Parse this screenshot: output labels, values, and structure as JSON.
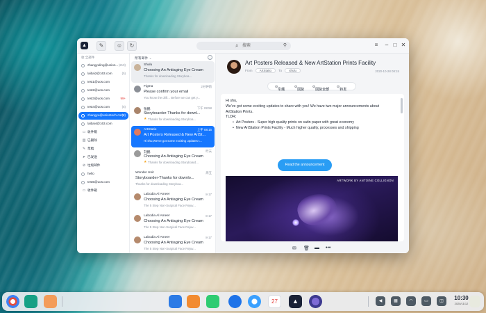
{
  "window": {
    "search_placeholder": "搜索"
  },
  "sidebar": {
    "header": "收 全部件",
    "accounts": [
      {
        "name": "zhangyuling@union...",
        "count": "(210)"
      },
      {
        "name": "laibai2@163.com",
        "count": "(5)"
      },
      {
        "name": "test1@uos.com",
        "count": ""
      },
      {
        "name": "test2@uos.com",
        "count": ""
      },
      {
        "name": "test3@uos.com",
        "count": "99+"
      },
      {
        "name": "test4@uos.com",
        "count": "(5)"
      },
      {
        "name": "zhangyu@uniontech.com",
        "count": "(2)"
      },
      {
        "name": "laibai4@163.com",
        "count": ""
      }
    ],
    "folders": [
      "收件箱",
      "已删除",
      "草稿",
      "已发送",
      "垃圾邮件"
    ],
    "extra_accounts": [
      {
        "name": "hello",
        "count": ""
      },
      {
        "name": "test5@uos.com",
        "count": ""
      }
    ],
    "last_folder": "收件箱"
  },
  "list": {
    "header": "所有邮件",
    "messages": [
      {
        "from": "Shulu",
        "time": "",
        "subject": "Choosing An Antiaging Eye Cream",
        "preview": "Thanks for downloading Storyboa...",
        "flag": false,
        "selected": false
      },
      {
        "from": "Figma",
        "time": "2分钟前",
        "subject": "Please confirm your email",
        "preview": "You know the drill... Before we can get y...",
        "flag": false,
        "selected": false
      },
      {
        "from": "张鹏",
        "time": "下午 08:58",
        "subject": "Storyboarder-Thanks for downl...",
        "preview": "Thanks for downloading Storyboa...",
        "flag": true,
        "selected": false
      },
      {
        "from": "ArtStatio",
        "time": "上午 08:15",
        "subject": "Art Posters Released & New ArtSt...",
        "preview": "Hi shu,We've got some exciting updates t...",
        "flag": false,
        "selected": true
      },
      {
        "from": "刘鹏",
        "time": "昨天",
        "subject": "Choosing An Antiaging Eye Cream",
        "preview": "Thanks for downloading Storyboard...",
        "flag": true,
        "selected": false
      },
      {
        "from": "Wonder Unit",
        "time": "周五",
        "subject": "Storyboarder-Thanks for downlo...",
        "preview": "Thanks for downloading Storyboa...",
        "flag": false,
        "selected": false
      },
      {
        "from": "Labodia Al Ameer",
        "time": "8-17",
        "subject": "Choosing An Antiaging Eye Cream",
        "preview": "The 5 Step Non-Surgical Face Rejuv...",
        "flag": false,
        "selected": false
      },
      {
        "from": "Labodia Al Ameer",
        "time": "8-17",
        "subject": "Choosing An Antiaging Eye Cream",
        "preview": "The 5 Step Non-Surgical Face Rejuv...",
        "flag": false,
        "selected": false
      },
      {
        "from": "Labodia Al Ameer",
        "time": "8-17",
        "subject": "Choosing An Antiaging Eye Cream",
        "preview": "The 5 Step Non-Surgical Face Rejuv...",
        "flag": false,
        "selected": false
      }
    ]
  },
  "reader": {
    "title": "Art Posters Released & New ArtStation Prints Facility",
    "from_label": "From",
    "from_value": "ArtStatio",
    "to_label": "To",
    "to_value": "shulu",
    "date": "2020-10-28 08:15",
    "actions": [
      "引藏",
      "回复",
      "回复全部",
      "转发"
    ],
    "body": {
      "greeting": "Hi shu,",
      "line1": "We've got some exciting updates to share with you! We have two major announcements about ArtStation Prints.",
      "tldr": "TLDR;",
      "bullet1": "Art Posters - Super high quality prints on satin paper with great economy",
      "bullet2": "New ArtStation Prints Facility - Much higher quality, processes and shipping"
    },
    "cta": "Read the announcement",
    "art_caption": "ARTWORK BY ANTOINE COLLIGNON"
  },
  "dock": {
    "time": "10:30",
    "date": "2020/11/12",
    "calendar_day": "27"
  }
}
